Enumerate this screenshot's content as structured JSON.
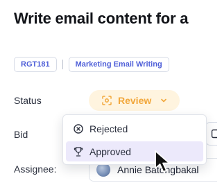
{
  "task": {
    "title": "Write email content for a"
  },
  "tags": [
    "RGT181",
    "Marketing Email Writing"
  ],
  "fields": {
    "status": {
      "label": "Status",
      "value": "Review"
    },
    "bid": {
      "label": "Bid"
    },
    "assignee": {
      "label": "Assignee:",
      "value": "Annie Batongbakal"
    }
  },
  "status_dropdown": {
    "options": [
      {
        "label": "Rejected",
        "icon": "x-circle-icon"
      },
      {
        "label": "Approved",
        "icon": "trophy-icon",
        "highlighted": true
      }
    ]
  },
  "colors": {
    "review_accent": "#f2a73b",
    "review_bg": "#fff4df",
    "tag_text": "#4f5fd8",
    "highlight_bg": "#ece9fb"
  }
}
